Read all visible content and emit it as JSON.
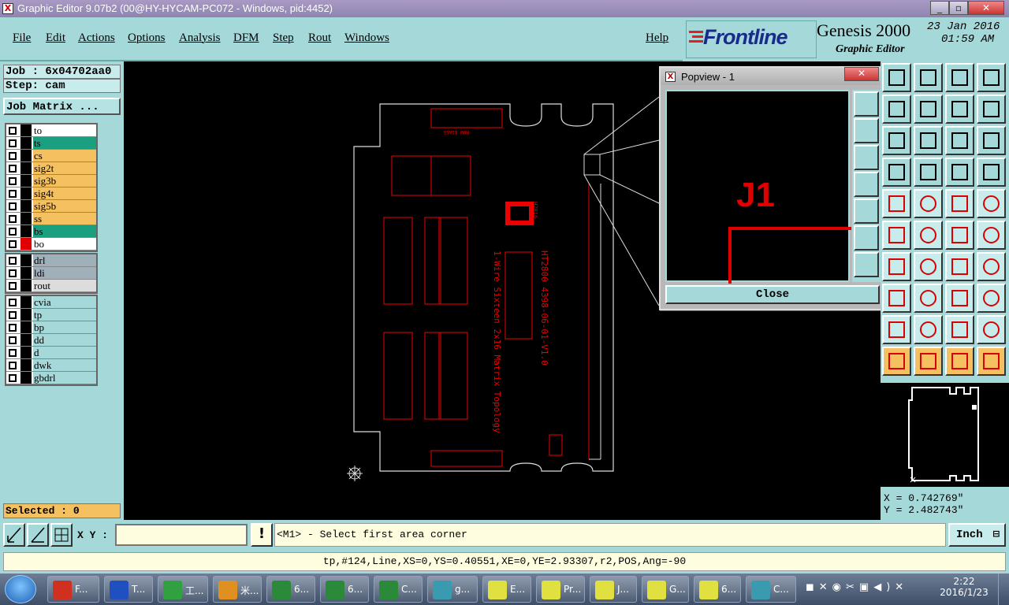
{
  "window": {
    "title": "Graphic Editor 9.07b2 (00@HY-HYCAM-PC072 - Windows, pid:4452)",
    "controls": [
      "_",
      "▫",
      "✕"
    ]
  },
  "menu": [
    "File",
    "Edit",
    "Actions",
    "Options",
    "Analysis",
    "DFM",
    "Step",
    "Rout",
    "Windows"
  ],
  "help": "Help",
  "brand": {
    "logo": "Frontline",
    "product": "Genesis 2000",
    "subtitle": "Graphic Editor",
    "date": "23 Jan 2016",
    "time": "01:59 AM"
  },
  "left": {
    "job": "Job : 6x04702aa0",
    "step": "Step: cam",
    "job_matrix": "Job Matrix ...",
    "layers_group1": [
      {
        "name": "to",
        "color": "#ffffff",
        "swatch": "#000000"
      },
      {
        "name": "ts",
        "color": "#1aa080",
        "swatch": "#000000"
      },
      {
        "name": "cs",
        "color": "#f5c060",
        "swatch": "#000000"
      },
      {
        "name": "sig2t",
        "color": "#f5c060",
        "swatch": "#000000"
      },
      {
        "name": "sig3b",
        "color": "#f5c060",
        "swatch": "#000000"
      },
      {
        "name": "sig4t",
        "color": "#f5c060",
        "swatch": "#000000"
      },
      {
        "name": "sig5b",
        "color": "#f5c060",
        "swatch": "#000000"
      },
      {
        "name": "ss",
        "color": "#f5c060",
        "swatch": "#000000"
      },
      {
        "name": "bs",
        "color": "#1aa080",
        "swatch": "#000000"
      },
      {
        "name": "bo",
        "color": "#ffffff",
        "swatch": "#e00000"
      }
    ],
    "layers_group2": [
      {
        "name": "drl",
        "color": "#9fb0bb",
        "swatch": "#000000"
      },
      {
        "name": "ldi",
        "color": "#9fb0bb",
        "swatch": "#000000"
      },
      {
        "name": "rout",
        "color": "#dcdcdc",
        "swatch": "#000000"
      }
    ],
    "layers_group3": [
      {
        "name": "cvia",
        "color": "#a5d9d9",
        "swatch": "#000000"
      },
      {
        "name": "tp",
        "color": "#a5d9d9",
        "swatch": "#000000"
      },
      {
        "name": "bp",
        "color": "#a5d9d9",
        "swatch": "#000000"
      },
      {
        "name": "dd",
        "color": "#a5d9d9",
        "swatch": "#000000"
      },
      {
        "name": "d",
        "color": "#a5d9d9",
        "swatch": "#000000"
      },
      {
        "name": "dwk",
        "color": "#a5d9d9",
        "swatch": "#000000"
      },
      {
        "name": "gbdrl",
        "color": "#a5d9d9",
        "swatch": "#000000"
      }
    ],
    "selected": "Selected : 0"
  },
  "board": {
    "rotated_text_1": "HT2800 4398-06-01-V1.0",
    "rotated_text_2": "1-Wire Sixteen 2x16 Matrix Topology",
    "rotated_text_3": "H2016",
    "small_label": "ROW BIAS5"
  },
  "popview": {
    "title": "Popview - 1",
    "label": "J1",
    "close": "Close"
  },
  "coords": {
    "x": "X = 0.742769\"",
    "y": "Y = 2.482743\""
  },
  "cmd": {
    "xy_label": "X Y :",
    "xy_value": "",
    "prompt": "<M1> - Select first area corner",
    "units": "Inch"
  },
  "status": "tp,#124,Line,XS=0,YS=0.40551,XE=0,YE=2.93307,r2,POS,Ang=-90",
  "taskbar": {
    "items": [
      {
        "label": "F...",
        "color": "#d03020"
      },
      {
        "label": "T...",
        "color": "#2050c0"
      },
      {
        "label": "工...",
        "color": "#30a040"
      },
      {
        "label": "米...",
        "color": "#e09020"
      },
      {
        "label": "6...",
        "color": "#2a8a3a"
      },
      {
        "label": "6...",
        "color": "#2a8a3a"
      },
      {
        "label": "C...",
        "color": "#2a8a3a"
      },
      {
        "label": "g...",
        "color": "#3a9ab0"
      },
      {
        "label": "E...",
        "color": "#e0e040"
      },
      {
        "label": "Pr...",
        "color": "#e0e040"
      },
      {
        "label": "J...",
        "color": "#e0e040"
      },
      {
        "label": "G...",
        "color": "#e0e040"
      },
      {
        "label": "6...",
        "color": "#e0e040"
      },
      {
        "label": "C...",
        "color": "#3a9ab0"
      }
    ],
    "time": "2:22",
    "date": "2016/1/23"
  }
}
